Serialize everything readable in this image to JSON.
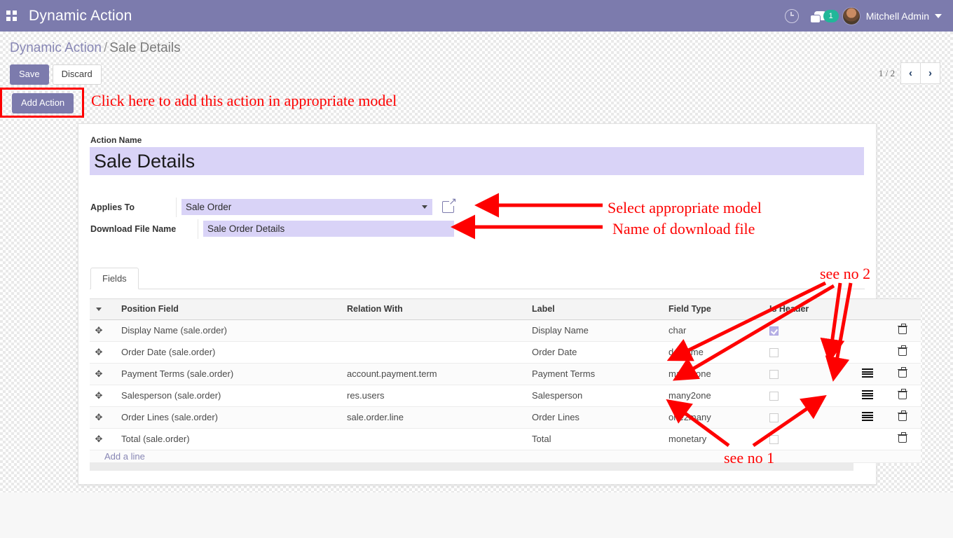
{
  "navbar": {
    "apps_icon": "apps-grid-icon",
    "title": "Dynamic Action",
    "clock_icon": "clock-icon",
    "messages_icon": "chat-bubble-icon",
    "messages_count": "1",
    "user_name": "Mitchell Admin",
    "user_caret_icon": "chevron-down-icon"
  },
  "control_panel": {
    "breadcrumb_root": "Dynamic Action",
    "breadcrumb_sep": "/",
    "breadcrumb_current": "Sale Details",
    "save_label": "Save",
    "discard_label": "Discard",
    "add_action_label": "Add Action",
    "pager_value": "1 / 2",
    "pager_prev_icon": "chevron-left-icon",
    "pager_next_icon": "chevron-right-icon"
  },
  "form": {
    "action_name_label": "Action Name",
    "action_name_value": "Sale Details",
    "applies_to_label": "Applies To",
    "applies_to_value": "Sale Order",
    "applies_to_external_icon": "external-link-icon",
    "download_file_label": "Download File Name",
    "download_file_value": "Sale Order Details"
  },
  "notebook": {
    "tabs": [
      {
        "label": "Fields",
        "active": true
      }
    ]
  },
  "table": {
    "columns": [
      "Position Field",
      "Relation With",
      "Label",
      "Field Type",
      "Is Header"
    ],
    "sort_indicator_icon": "caret-down-icon",
    "rows": [
      {
        "position_field": "Display Name (sale.order)",
        "relation_with": "",
        "label": "Display Name",
        "field_type": "char",
        "is_header": true,
        "has_list_icon": false
      },
      {
        "position_field": "Order Date (sale.order)",
        "relation_with": "",
        "label": "Order Date",
        "field_type": "datetime",
        "is_header": false,
        "has_list_icon": false
      },
      {
        "position_field": "Payment Terms (sale.order)",
        "relation_with": "account.payment.term",
        "label": "Payment Terms",
        "field_type": "many2one",
        "is_header": false,
        "has_list_icon": true
      },
      {
        "position_field": "Salesperson (sale.order)",
        "relation_with": "res.users",
        "label": "Salesperson",
        "field_type": "many2one",
        "is_header": false,
        "has_list_icon": true
      },
      {
        "position_field": "Order Lines (sale.order)",
        "relation_with": "sale.order.line",
        "label": "Order Lines",
        "field_type": "one2many",
        "is_header": false,
        "has_list_icon": true
      },
      {
        "position_field": "Total (sale.order)",
        "relation_with": "",
        "label": "Total",
        "field_type": "monetary",
        "is_header": false,
        "has_list_icon": false
      }
    ],
    "add_a_line_label": "Add a line",
    "row_handle_icon": "drag-handle-icon",
    "row_list_icon": "list-lines-icon",
    "row_delete_icon": "trash-icon"
  },
  "annotations": {
    "color": "#fe0000",
    "add_action_note": "Click here to add this action in appropriate model",
    "applies_to_note": "Select appropriate model",
    "download_file_note": "Name of download file",
    "see_no_2": "see no 2",
    "see_no_1": "see no 1"
  }
}
